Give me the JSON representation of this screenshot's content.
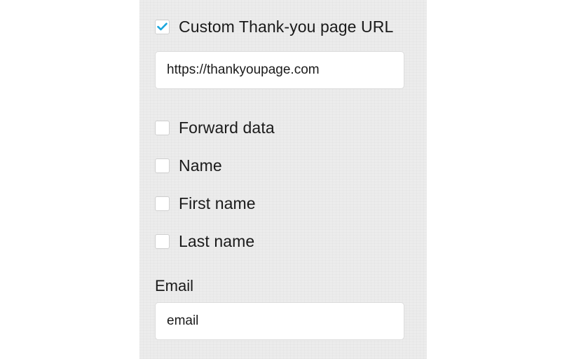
{
  "thankyou": {
    "checkbox_checked": true,
    "label": "Custom Thank-you page URL",
    "url_value": "https://thankyoupage.com"
  },
  "options": [
    {
      "label": "Forward data",
      "checked": false
    },
    {
      "label": "Name",
      "checked": false
    },
    {
      "label": "First name",
      "checked": false
    },
    {
      "label": "Last name",
      "checked": false
    }
  ],
  "email": {
    "label": "Email",
    "value": "email"
  },
  "colors": {
    "check_accent": "#1aa6dd",
    "panel_bg": "#ececec"
  }
}
